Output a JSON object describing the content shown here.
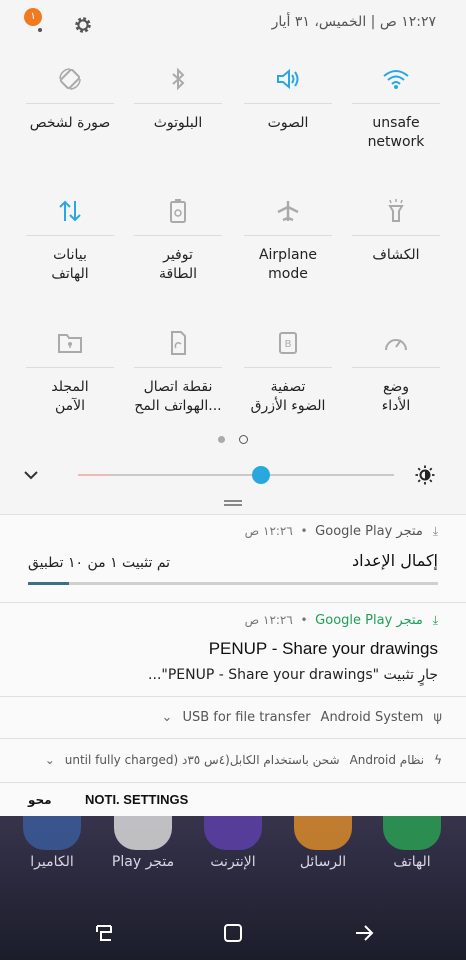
{
  "status_bar": {
    "badge_count": "١",
    "clock_text": "١٢:٢٧ ص  |  الخميس، ٣١ أيار"
  },
  "quick_tiles": [
    {
      "label": "unsafe\nnetwork",
      "icon": "wifi-icon",
      "active": true
    },
    {
      "label": "الصوت",
      "icon": "sound-icon",
      "active": true
    },
    {
      "label": "البلوتوث",
      "icon": "bluetooth-icon",
      "active": false
    },
    {
      "label": "صورة لشخص",
      "icon": "auto-rotate-icon",
      "active": false
    },
    {
      "label": "الكشاف",
      "icon": "flashlight-icon",
      "active": false
    },
    {
      "label": "Airplane\nmode",
      "icon": "airplane-icon",
      "active": false
    },
    {
      "label": "توفير\nالطاقة",
      "icon": "battery-saver-icon",
      "active": false
    },
    {
      "label": "بيانات\nالهاتف",
      "icon": "mobile-data-icon",
      "active": true
    },
    {
      "label": "وضع\nالأداء",
      "icon": "performance-icon",
      "active": false
    },
    {
      "label": "تصفية\nالضوء الأزرق",
      "icon": "blue-light-icon",
      "active": false
    },
    {
      "label": "نقطة اتصال\nالهواتف المح...",
      "icon": "hotspot-icon",
      "active": false
    },
    {
      "label": "المجلد\nالآمن",
      "icon": "secure-folder-icon",
      "active": false
    }
  ],
  "brightness": {
    "level": 0.58
  },
  "notifications": {
    "setup": {
      "app": "متجر Google Play",
      "time": "١٢:٢٦ ص",
      "title": "إكمال الإعداد",
      "progress_text": "تم تثبيت ١ من ١٠ تطبيق",
      "progress": 0.1
    },
    "penup": {
      "app": "متجر Google Play",
      "time": "١٢:٢٦ ص",
      "title": "PENUP - Share your drawings",
      "subtitle": "جارٍ تثبيت \"PENUP - Share your drawings\"..."
    },
    "usb": {
      "source": "Android System",
      "text": "USB for file transfer"
    },
    "charging": {
      "source": "نظام Android",
      "text": "شحن باستخدام الكابل(٤س ٣٥د (until fully charged"
    }
  },
  "footer": {
    "settings_label": "NOTI. SETTINGS",
    "clear_label": "محو"
  },
  "dock": [
    {
      "label": "الكاميرا",
      "icon": "camera-icon",
      "color": "#3b5a9a"
    },
    {
      "label": "Play متجر",
      "icon": "play-store-icon",
      "color": "#e8e8e8"
    },
    {
      "label": "الإنترنت",
      "icon": "internet-icon",
      "color": "#5c3fa8"
    },
    {
      "label": "الرسائل",
      "icon": "messages-icon",
      "color": "#f0a030"
    },
    {
      "label": "الهاتف",
      "icon": "phone-icon",
      "color": "#2fae5a"
    }
  ],
  "colors": {
    "accent": "#29a8e0",
    "green": "#1e9e5a",
    "badge": "#f07a21"
  }
}
